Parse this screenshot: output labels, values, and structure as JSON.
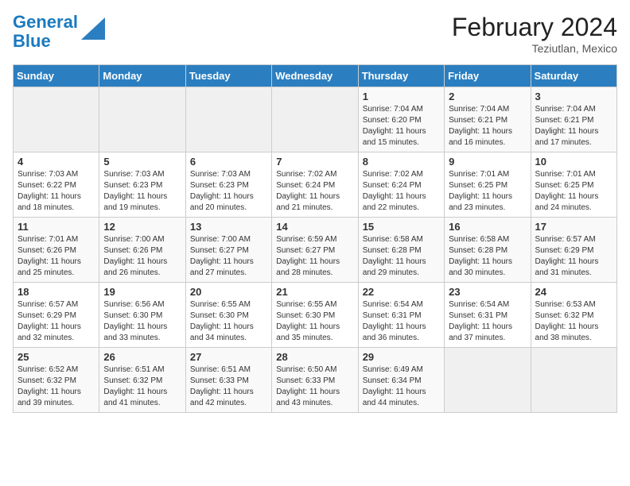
{
  "header": {
    "logo_line1": "General",
    "logo_line2": "Blue",
    "month_year": "February 2024",
    "location": "Teziutlan, Mexico"
  },
  "weekdays": [
    "Sunday",
    "Monday",
    "Tuesday",
    "Wednesday",
    "Thursday",
    "Friday",
    "Saturday"
  ],
  "weeks": [
    [
      {
        "day": "",
        "info": ""
      },
      {
        "day": "",
        "info": ""
      },
      {
        "day": "",
        "info": ""
      },
      {
        "day": "",
        "info": ""
      },
      {
        "day": "1",
        "info": "Sunrise: 7:04 AM\nSunset: 6:20 PM\nDaylight: 11 hours and 15 minutes."
      },
      {
        "day": "2",
        "info": "Sunrise: 7:04 AM\nSunset: 6:21 PM\nDaylight: 11 hours and 16 minutes."
      },
      {
        "day": "3",
        "info": "Sunrise: 7:04 AM\nSunset: 6:21 PM\nDaylight: 11 hours and 17 minutes."
      }
    ],
    [
      {
        "day": "4",
        "info": "Sunrise: 7:03 AM\nSunset: 6:22 PM\nDaylight: 11 hours and 18 minutes."
      },
      {
        "day": "5",
        "info": "Sunrise: 7:03 AM\nSunset: 6:23 PM\nDaylight: 11 hours and 19 minutes."
      },
      {
        "day": "6",
        "info": "Sunrise: 7:03 AM\nSunset: 6:23 PM\nDaylight: 11 hours and 20 minutes."
      },
      {
        "day": "7",
        "info": "Sunrise: 7:02 AM\nSunset: 6:24 PM\nDaylight: 11 hours and 21 minutes."
      },
      {
        "day": "8",
        "info": "Sunrise: 7:02 AM\nSunset: 6:24 PM\nDaylight: 11 hours and 22 minutes."
      },
      {
        "day": "9",
        "info": "Sunrise: 7:01 AM\nSunset: 6:25 PM\nDaylight: 11 hours and 23 minutes."
      },
      {
        "day": "10",
        "info": "Sunrise: 7:01 AM\nSunset: 6:25 PM\nDaylight: 11 hours and 24 minutes."
      }
    ],
    [
      {
        "day": "11",
        "info": "Sunrise: 7:01 AM\nSunset: 6:26 PM\nDaylight: 11 hours and 25 minutes."
      },
      {
        "day": "12",
        "info": "Sunrise: 7:00 AM\nSunset: 6:26 PM\nDaylight: 11 hours and 26 minutes."
      },
      {
        "day": "13",
        "info": "Sunrise: 7:00 AM\nSunset: 6:27 PM\nDaylight: 11 hours and 27 minutes."
      },
      {
        "day": "14",
        "info": "Sunrise: 6:59 AM\nSunset: 6:27 PM\nDaylight: 11 hours and 28 minutes."
      },
      {
        "day": "15",
        "info": "Sunrise: 6:58 AM\nSunset: 6:28 PM\nDaylight: 11 hours and 29 minutes."
      },
      {
        "day": "16",
        "info": "Sunrise: 6:58 AM\nSunset: 6:28 PM\nDaylight: 11 hours and 30 minutes."
      },
      {
        "day": "17",
        "info": "Sunrise: 6:57 AM\nSunset: 6:29 PM\nDaylight: 11 hours and 31 minutes."
      }
    ],
    [
      {
        "day": "18",
        "info": "Sunrise: 6:57 AM\nSunset: 6:29 PM\nDaylight: 11 hours and 32 minutes."
      },
      {
        "day": "19",
        "info": "Sunrise: 6:56 AM\nSunset: 6:30 PM\nDaylight: 11 hours and 33 minutes."
      },
      {
        "day": "20",
        "info": "Sunrise: 6:55 AM\nSunset: 6:30 PM\nDaylight: 11 hours and 34 minutes."
      },
      {
        "day": "21",
        "info": "Sunrise: 6:55 AM\nSunset: 6:30 PM\nDaylight: 11 hours and 35 minutes."
      },
      {
        "day": "22",
        "info": "Sunrise: 6:54 AM\nSunset: 6:31 PM\nDaylight: 11 hours and 36 minutes."
      },
      {
        "day": "23",
        "info": "Sunrise: 6:54 AM\nSunset: 6:31 PM\nDaylight: 11 hours and 37 minutes."
      },
      {
        "day": "24",
        "info": "Sunrise: 6:53 AM\nSunset: 6:32 PM\nDaylight: 11 hours and 38 minutes."
      }
    ],
    [
      {
        "day": "25",
        "info": "Sunrise: 6:52 AM\nSunset: 6:32 PM\nDaylight: 11 hours and 39 minutes."
      },
      {
        "day": "26",
        "info": "Sunrise: 6:51 AM\nSunset: 6:32 PM\nDaylight: 11 hours and 41 minutes."
      },
      {
        "day": "27",
        "info": "Sunrise: 6:51 AM\nSunset: 6:33 PM\nDaylight: 11 hours and 42 minutes."
      },
      {
        "day": "28",
        "info": "Sunrise: 6:50 AM\nSunset: 6:33 PM\nDaylight: 11 hours and 43 minutes."
      },
      {
        "day": "29",
        "info": "Sunrise: 6:49 AM\nSunset: 6:34 PM\nDaylight: 11 hours and 44 minutes."
      },
      {
        "day": "",
        "info": ""
      },
      {
        "day": "",
        "info": ""
      }
    ]
  ]
}
